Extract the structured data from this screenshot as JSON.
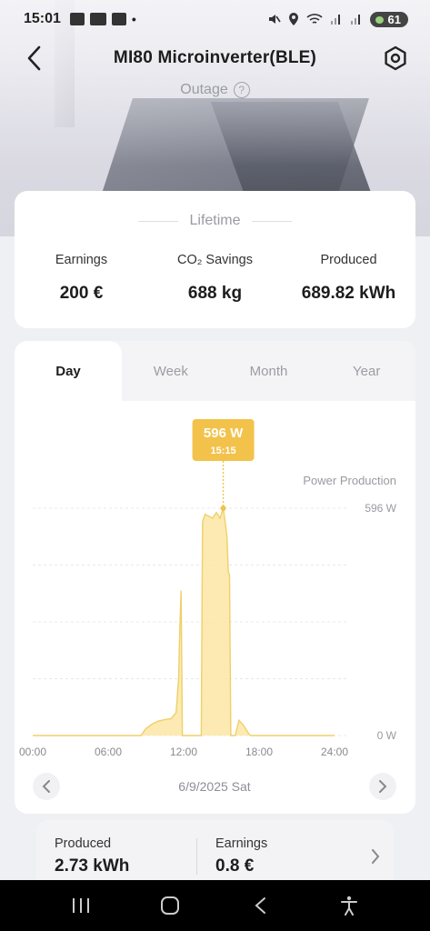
{
  "status_bar": {
    "time": "15:01",
    "battery": "61"
  },
  "header": {
    "title": "MI80 Microinverter(BLE)",
    "status": "Outage"
  },
  "lifetime": {
    "heading": "Lifetime",
    "stats": [
      {
        "label": "Earnings",
        "value": "200 €"
      },
      {
        "label": "CO₂ Savings",
        "value": "688 kg"
      },
      {
        "label": "Produced",
        "value": "689.82 kWh"
      }
    ]
  },
  "tabs": [
    "Day",
    "Week",
    "Month",
    "Year"
  ],
  "active_tab": "Day",
  "tooltip": {
    "value": "596 W",
    "time": "15:15"
  },
  "date_nav": {
    "date": "6/9/2025 Sat"
  },
  "summary": {
    "produced_label": "Produced",
    "produced_value": "2.73 kWh",
    "earnings_label": "Earnings",
    "earnings_value": "0.8 €"
  },
  "colors": {
    "accent": "#f2c24a",
    "fill": "#fbe6a4",
    "line": "#f0cf6a"
  },
  "chart_data": {
    "type": "area",
    "legend": "Power Production",
    "x_tick_labels": [
      "00:00",
      "06:00",
      "12:00",
      "18:00",
      "24:00"
    ],
    "y_tick_labels": [
      "596 W",
      "0 W"
    ],
    "xlim": [
      0,
      24
    ],
    "ylim": [
      0,
      596
    ],
    "grid": true,
    "x": [
      0,
      8.6,
      9.0,
      9.5,
      10.0,
      10.5,
      11.0,
      11.4,
      11.6,
      11.7,
      11.8,
      11.85,
      11.9,
      12.5,
      13.4,
      13.5,
      13.7,
      14.0,
      14.3,
      14.6,
      14.9,
      15.15,
      15.3,
      15.45,
      15.55,
      15.65,
      15.7,
      15.75,
      16.0,
      16.1,
      16.4,
      16.8,
      17.1,
      17.3,
      18.0,
      24.0
    ],
    "y": [
      0,
      0,
      18,
      30,
      38,
      42,
      44,
      60,
      150,
      280,
      380,
      200,
      0,
      0,
      0,
      560,
      580,
      575,
      570,
      585,
      570,
      596,
      560,
      520,
      430,
      420,
      200,
      0,
      0,
      0,
      40,
      25,
      8,
      0,
      0,
      0
    ]
  }
}
